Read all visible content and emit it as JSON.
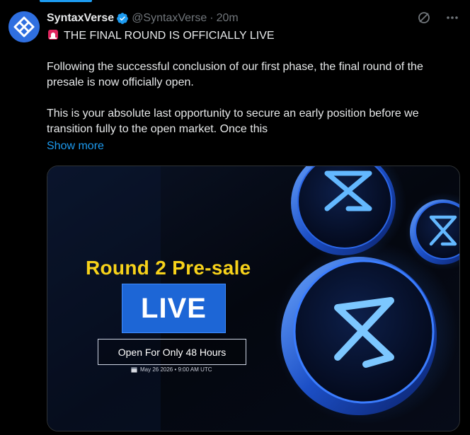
{
  "tweet": {
    "display_name": "SyntaxVerse",
    "handle": "@SyntaxVerse",
    "separator": "·",
    "time": "20m",
    "line1": "THE FINAL ROUND IS OFFICIALLY LIVE",
    "paragraph2": "Following the successful conclusion of our first phase, the final round of the presale is now officially open.",
    "paragraph3": "This is your absolute last opportunity to secure an early position before we transition fully to the open market. Once this",
    "show_more": "Show more"
  },
  "media": {
    "title": "Round 2 Pre-sale",
    "live": "LIVE",
    "duration": "Open For Only 48 Hours",
    "date": "May 26 2026 • 9:00 AM UTC"
  },
  "icons": {
    "avatar": "syntaxverse-logo-icon",
    "verified": "verified-badge-icon",
    "grok": "grok-icon",
    "more": "more-icon",
    "siren": "siren-icon",
    "calendar": "calendar-icon"
  },
  "colors": {
    "background": "#000000",
    "text": "#e7e9ea",
    "muted": "#71767b",
    "link": "#1d9bf0",
    "title_yellow": "#f7d21a",
    "live_blue": "#1d66d6"
  }
}
